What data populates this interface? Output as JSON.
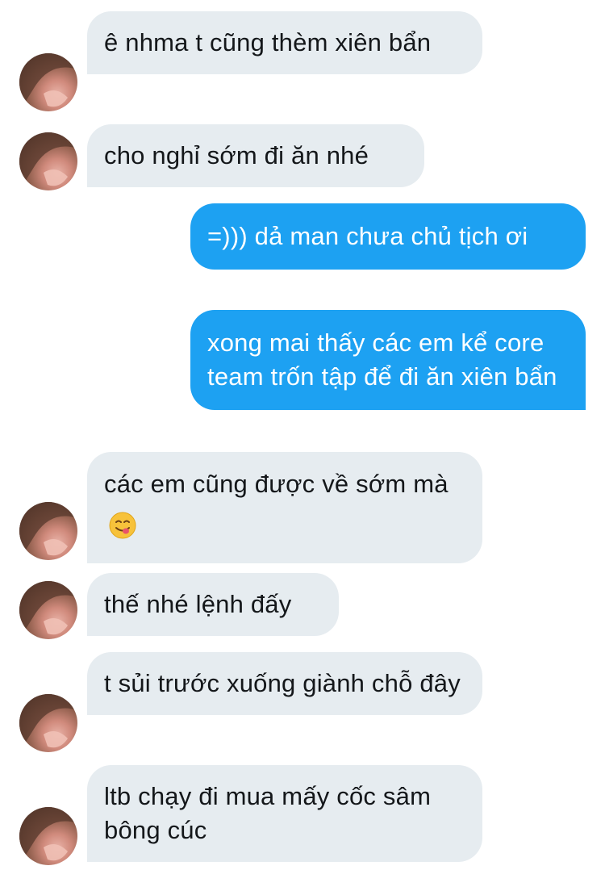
{
  "messages": [
    {
      "side": "incoming",
      "text": "ê nhma t cũng thèm xiên bẩn"
    },
    {
      "side": "incoming",
      "text": "cho nghỉ sớm đi ăn nhé"
    },
    {
      "side": "outgoing",
      "text": "=))) dả man chưa chủ tịch ơi"
    },
    {
      "side": "outgoing",
      "text": "xong mai thấy các em kể core team trốn tập để đi ăn xiên bẩn"
    },
    {
      "side": "incoming",
      "text": "các em cũng được về sớm mà",
      "emoji": "savoring-face-emoji"
    },
    {
      "side": "incoming",
      "text": "thế nhé lệnh đấy"
    },
    {
      "side": "incoming",
      "text": "t sủi trước xuống giành chỗ đây"
    },
    {
      "side": "incoming",
      "text": "ltb chạy đi mua mấy cốc sâm bông cúc"
    }
  ],
  "avatar": {
    "icon": "contact-avatar"
  },
  "colors": {
    "incoming_bubble": "#e6ecf0",
    "outgoing_bubble": "#1da1f2",
    "incoming_text": "#14171a",
    "outgoing_text": "#ffffff"
  }
}
